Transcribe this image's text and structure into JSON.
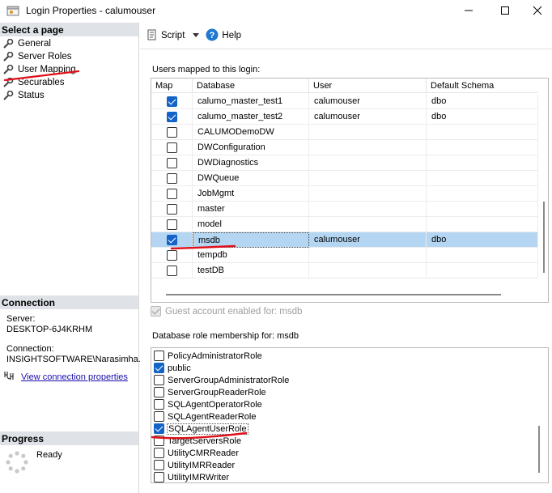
{
  "window": {
    "title": "Login Properties - calumouser"
  },
  "left": {
    "select_page_header": "Select a page",
    "pages": [
      {
        "label": "General"
      },
      {
        "label": "Server Roles"
      },
      {
        "label": "User Mapping"
      },
      {
        "label": "Securables"
      },
      {
        "label": "Status"
      }
    ],
    "connection_header": "Connection",
    "server_label": "Server:",
    "server_value": "DESKTOP-6J4KRHM",
    "connection_label": "Connection:",
    "connection_value": "INSIGHTSOFTWARE\\Narasimha.",
    "view_link": "View connection properties",
    "progress_header": "Progress",
    "progress_status": "Ready"
  },
  "toolbar": {
    "script_label": "Script",
    "help_label": "Help"
  },
  "users_grid": {
    "label": "Users mapped to this login:",
    "columns": {
      "map": "Map",
      "database": "Database",
      "user": "User",
      "schema": "Default Schema"
    },
    "rows": [
      {
        "checked": true,
        "database": "calumo_master_test1",
        "user": "calumouser",
        "schema": "dbo"
      },
      {
        "checked": true,
        "database": "calumo_master_test2",
        "user": "calumouser",
        "schema": "dbo"
      },
      {
        "checked": false,
        "database": "CALUMODemoDW",
        "user": "",
        "schema": ""
      },
      {
        "checked": false,
        "database": "DWConfiguration",
        "user": "",
        "schema": ""
      },
      {
        "checked": false,
        "database": "DWDiagnostics",
        "user": "",
        "schema": ""
      },
      {
        "checked": false,
        "database": "DWQueue",
        "user": "",
        "schema": ""
      },
      {
        "checked": false,
        "database": "JobMgmt",
        "user": "",
        "schema": ""
      },
      {
        "checked": false,
        "database": "master",
        "user": "",
        "schema": ""
      },
      {
        "checked": false,
        "database": "model",
        "user": "",
        "schema": ""
      },
      {
        "checked": true,
        "database": "msdb",
        "user": "calumouser",
        "schema": "dbo",
        "selected": true
      },
      {
        "checked": false,
        "database": "tempdb",
        "user": "",
        "schema": ""
      },
      {
        "checked": false,
        "database": "testDB",
        "user": "",
        "schema": ""
      }
    ]
  },
  "guest": {
    "label": "Guest account enabled for: msdb",
    "checked": true
  },
  "roles": {
    "label": "Database role membership for: msdb",
    "items": [
      {
        "label": "PolicyAdministratorRole",
        "checked": false
      },
      {
        "label": "public",
        "checked": true
      },
      {
        "label": "ServerGroupAdministratorRole",
        "checked": false
      },
      {
        "label": "ServerGroupReaderRole",
        "checked": false
      },
      {
        "label": "SQLAgentOperatorRole",
        "checked": false
      },
      {
        "label": "SQLAgentReaderRole",
        "checked": false
      },
      {
        "label": "SQLAgentUserRole",
        "checked": true,
        "active": true
      },
      {
        "label": "TargetServersRole",
        "checked": false
      },
      {
        "label": "UtilityCMRReader",
        "checked": false
      },
      {
        "label": "UtilityIMRReader",
        "checked": false
      },
      {
        "label": "UtilityIMRWriter",
        "checked": false
      }
    ]
  },
  "colors": {
    "accent": "#1464c8",
    "selection": "#b4d6f2",
    "annotation": "#e0101a",
    "section_header": "#dfe3e8",
    "link": "#1a0dab"
  }
}
